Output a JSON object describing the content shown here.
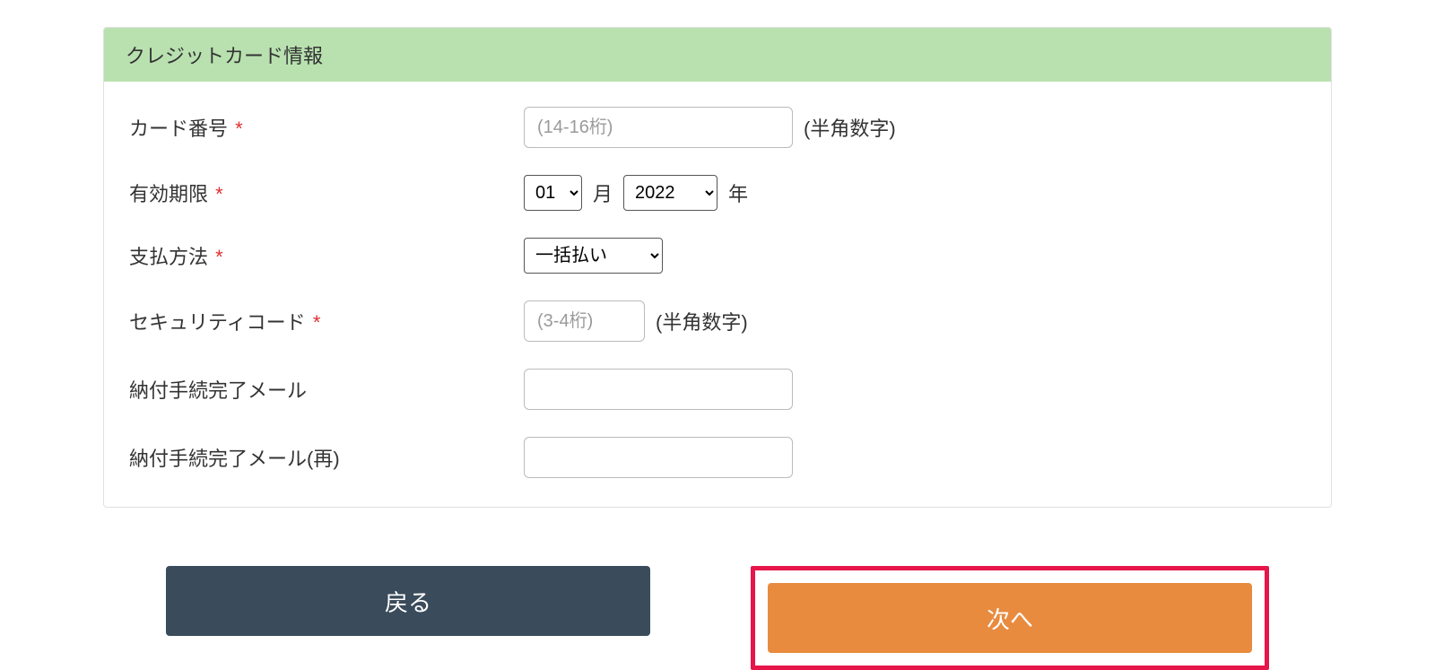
{
  "panel": {
    "title": "クレジットカード情報"
  },
  "form": {
    "card_number": {
      "label": "カード番号",
      "required_mark": "*",
      "placeholder": "(14-16桁)",
      "value": "",
      "hint": "(半角数字)"
    },
    "expiry": {
      "label": "有効期限",
      "required_mark": "*",
      "month_value": "01",
      "month_unit": "月",
      "year_value": "2022",
      "year_unit": "年"
    },
    "payment_method": {
      "label": "支払方法",
      "required_mark": "*",
      "value": "一括払い"
    },
    "security_code": {
      "label": "セキュリティコード",
      "required_mark": "*",
      "placeholder": "(3-4桁)",
      "value": "",
      "hint": "(半角数字)"
    },
    "email": {
      "label": "納付手続完了メール",
      "value": ""
    },
    "email_confirm": {
      "label": "納付手続完了メール(再)",
      "value": ""
    }
  },
  "buttons": {
    "back": "戻る",
    "next": "次へ"
  }
}
